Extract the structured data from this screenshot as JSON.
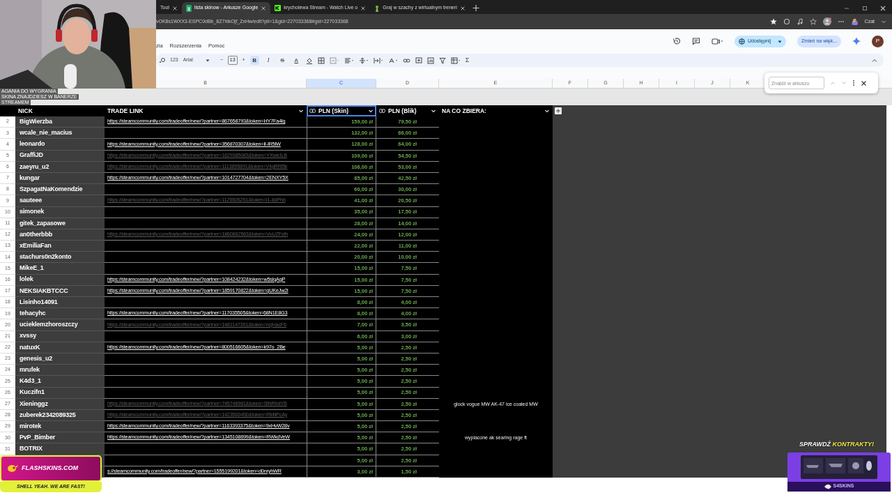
{
  "browser": {
    "tabs": [
      {
        "title": "Tool",
        "selected": false
      },
      {
        "title": "lista skinow - Arkusze Google",
        "selected": true
      },
      {
        "title": "krycholewa Stream - Watch Live o",
        "selected": false
      },
      {
        "title": "Graj w szachy z wirtualnym treneri",
        "selected": false
      }
    ],
    "url": "vOK8s1WXX3-ESPC0dBb_8Z7hlkOjf_ZxHw/edit?pli=1&gid=227033368#gid=227033368",
    "chat_label": "Czat"
  },
  "sheets": {
    "menu": [
      "zia",
      "Rozszerzenia",
      "Pomoc"
    ],
    "share_button": "Udostępnij",
    "upgrade_button": "Zmień na więk...",
    "avatar": "P",
    "toolbar": {
      "number_format": "123",
      "font": "Arial",
      "decrease": "−",
      "font_size": "13",
      "increase": "+",
      "format_buttons": [
        {
          "label": "B",
          "kind": "bold",
          "selected": true
        },
        {
          "label": "I",
          "kind": "italic",
          "selected": false
        },
        {
          "label": "S",
          "kind": "strike",
          "selected": false
        },
        {
          "label": "A",
          "kind": "color",
          "selected": false
        }
      ],
      "sum": "Σ"
    },
    "find": {
      "placeholder": "Znajdź w arkuszu"
    },
    "column_letters": [
      {
        "label": "B",
        "selected": false
      },
      {
        "label": "C",
        "selected": true
      },
      {
        "label": "D",
        "selected": false
      },
      {
        "label": "E",
        "selected": false
      },
      {
        "label": "F",
        "selected": false
      },
      {
        "label": "G",
        "selected": false
      },
      {
        "label": "H",
        "selected": false
      },
      {
        "label": "I",
        "selected": false
      },
      {
        "label": "J",
        "selected": false
      },
      {
        "label": "K",
        "selected": false
      }
    ]
  },
  "table": {
    "columns": [
      {
        "label": "NICK",
        "linked": false,
        "dropdown": false,
        "selected": false
      },
      {
        "label": "TRADE LINK",
        "linked": false,
        "dropdown": true,
        "selected": false
      },
      {
        "label": "PLN (Skin)",
        "linked": true,
        "dropdown": true,
        "selected": true
      },
      {
        "label": "PLN (Blik)",
        "linked": true,
        "dropdown": true,
        "selected": false
      },
      {
        "label": "NA CO ZBIERA:",
        "linked": false,
        "dropdown": true,
        "selected": false
      }
    ],
    "rows": [
      {
        "number": "2",
        "nick": "BigWierzba",
        "link": "https://steamcommunity.com/tradeoffer/new/?partner=867658793&token=HY7Fa4lg",
        "faded": false,
        "pln_skin": "159,00 zł",
        "pln_blik": "79,50 zł"
      },
      {
        "number": "3",
        "nick": "wcale_nie_macius",
        "pln_skin": "132,00 zł",
        "pln_blik": "66,00 zł"
      },
      {
        "number": "4",
        "nick": "leonardo",
        "link": "https://steamcommunity.com/tradeoffer/new/?partner=356870307&token=lI-IR5lW",
        "faded": false,
        "pln_skin": "128,00 zł",
        "pln_blik": "64,00 zł"
      },
      {
        "number": "5",
        "nick": "GraffiJD",
        "link": "https://steamcommunity.com/tradeoffer/new/?partner=1629385083&token=YXwicILB",
        "faded": true,
        "pln_skin": "109,00 zł",
        "pln_blik": "54,50 zł"
      },
      {
        "number": "6",
        "nick": "zaeyru_u2",
        "link": "https://steamcommunity.com/tradeoffer/new/?partner=1113895891&token=V4gRRi5k",
        "faded": true,
        "pln_skin": "106,00 zł",
        "pln_blik": "53,00 zł"
      },
      {
        "number": "7",
        "nick": "kungar",
        "link": "https://steamcommunity.com/tradeoffer/new/?partner=1014727704&token=2ENXY5X",
        "faded": false,
        "pln_skin": "85,00 zł",
        "pln_blik": "42,50 zł"
      },
      {
        "number": "8",
        "nick": "SzpagatNaKomendzie",
        "pln_skin": "60,00 zł",
        "pln_blik": "30,00 zł"
      },
      {
        "number": "9",
        "nick": "sauteee",
        "link": "https://steamcommunity.com/tradeoffer/new/?partner=1125505251&token=I1-8dPhb",
        "faded": true,
        "pln_skin": "41,00 zł",
        "pln_blik": "20,50 zł"
      },
      {
        "number": "10",
        "nick": "simonek",
        "pln_skin": "35,00 zł",
        "pln_blik": "17,50 zł"
      },
      {
        "number": "11",
        "nick": "gitek_zapasowe",
        "pln_skin": "28,00 zł",
        "pln_blik": "14,00 zł"
      },
      {
        "number": "12",
        "nick": "an0therbbb",
        "link": "https://steamcommunity.com/tradeoffer/new/?partner=1860662563&token=VoUZFsth",
        "faded": true,
        "pln_skin": "24,00 zł",
        "pln_blik": "12,00 zł"
      },
      {
        "number": "13",
        "nick": "xEmiliaFan",
        "pln_skin": "22,00 zł",
        "pln_blik": "11,00 zł"
      },
      {
        "number": "14",
        "nick": "stachurs0n2konto",
        "pln_skin": "20,00 zł",
        "pln_blik": "10,00 zł"
      },
      {
        "number": "15",
        "nick": "MikeE_1",
        "pln_skin": "15,00 zł",
        "pln_blik": "7,50 zł"
      },
      {
        "number": "16",
        "nick": "lolek",
        "link": "https://steamcommunity.com/tradeoffer/new/?partner=108424232&token=w5slqAgP",
        "faded": false,
        "pln_skin": "15,00 zł",
        "pln_blik": "7,50 zł"
      },
      {
        "number": "17",
        "nick": "NEKSIAKBTCCC",
        "link": "https://steamcommunity.com/tradeoffer/new/?partner=1859170822&token=gUKeJw2i",
        "faded": false,
        "pln_skin": "15,00 zł",
        "pln_blik": "7,50 zł"
      },
      {
        "number": "18",
        "nick": "Lisinho14091",
        "pln_skin": "8,00 zł",
        "pln_blik": "4,00 zł"
      },
      {
        "number": "19",
        "nick": "tehacyhc",
        "link": "https://steamcommunity.com/tradeoffer/new/?partner=117035505&token=68N1E8G3",
        "faded": false,
        "pln_skin": "8,00 zł",
        "pln_blik": "4,00 zł"
      },
      {
        "number": "20",
        "nick": "ucieklemzhoroszczy",
        "link": "https://steamcommunity.com/tradeoffer/new/?partner=1481147351&token=ncjHacF6",
        "faded": true,
        "pln_skin": "7,00 zł",
        "pln_blik": "3,50 zł"
      },
      {
        "number": "21",
        "nick": "xvssy",
        "pln_skin": "6,00 zł",
        "pln_blik": "3,00 zł"
      },
      {
        "number": "22",
        "nick": "natuxK",
        "link": "https://steamcommunity.com/tradeoffer/new/?partner=800516605&token=k97o_2Be",
        "faded": false,
        "pln_skin": "5,00 zł",
        "pln_blik": "2,50 zł"
      },
      {
        "number": "23",
        "nick": "genesis_u2",
        "pln_skin": "5,00 zł",
        "pln_blik": "2,50 zł"
      },
      {
        "number": "24",
        "nick": "mrufek",
        "pln_skin": "5,00 zł",
        "pln_blik": "2,50 zł"
      },
      {
        "number": "25",
        "nick": "K4d3_1",
        "pln_skin": "5,00 zł",
        "pln_blik": "2,50 zł"
      },
      {
        "number": "26",
        "nick": "Kuczifn1",
        "pln_skin": "5,00 zł",
        "pln_blik": "2,50 zł"
      },
      {
        "number": "27",
        "nick": "Xieninggz",
        "link": "https://steamcommunity.com/tradeoffer/new/?partner=745746981&token=SlNRbdYB",
        "faded": true,
        "pln_skin": "5,00 zł",
        "pln_blik": "2,50 zł",
        "note": "glock vogue MW AK-47 ice coaled MW"
      },
      {
        "number": "28",
        "nick": "zuberek2342089325",
        "link": "https://steamcommunity.com/tradeoffer/new/?partner=1423500450&token=RMiiPcAy",
        "faded": true,
        "pln_skin": "5,00 zł",
        "pln_blik": "2,50 zł"
      },
      {
        "number": "29",
        "nick": "mirotek",
        "link": "https://steamcommunity.com/tradeoffer/new/?partner=1163393375&token=9xHvW28v",
        "faded": false,
        "pln_skin": "5,00 zł",
        "pln_blik": "2,50 zł"
      },
      {
        "number": "30",
        "nick": "PvP_Bimber",
        "link": "https://steamcommunity.com/tradeoffer/new/?partner=1345108699&token=RWkdVeW",
        "faded": false,
        "pln_skin": "5,00 zł",
        "pln_blik": "2,50 zł",
        "note": "wyplacone ak searing rage ft"
      },
      {
        "number": "31",
        "nick": "BOTRIX",
        "pln_skin": "5,00 zł",
        "pln_blik": "2,50 zł"
      },
      {
        "pln_skin": "5,00 zł",
        "pln_blik": "2,50 zł"
      },
      {
        "link": "s://steamcommunity.com/tradeoffer/new/?partner=1555199201&token=d0nryhWR",
        "faded": false,
        "pln_skin": "3,00 zł",
        "pln_blik": "1,50 zł"
      }
    ]
  },
  "overlays": {
    "webcam": {
      "kind": "picture"
    },
    "stream_notice": [
      "AGANIA DO WYGRANIA",
      "SKINA ZNAJDZIESZ W BANERZE",
      "STREAMEM"
    ],
    "flashskins": {
      "logo": "FLASHSKINS.COM",
      "slogan": "SHELL YEAH. WE ARE FAST!"
    },
    "promo": {
      "headline": "SPRAWDŹ",
      "headline_accent": "KONTRAKTY!",
      "logo": "S4SKINS"
    }
  }
}
